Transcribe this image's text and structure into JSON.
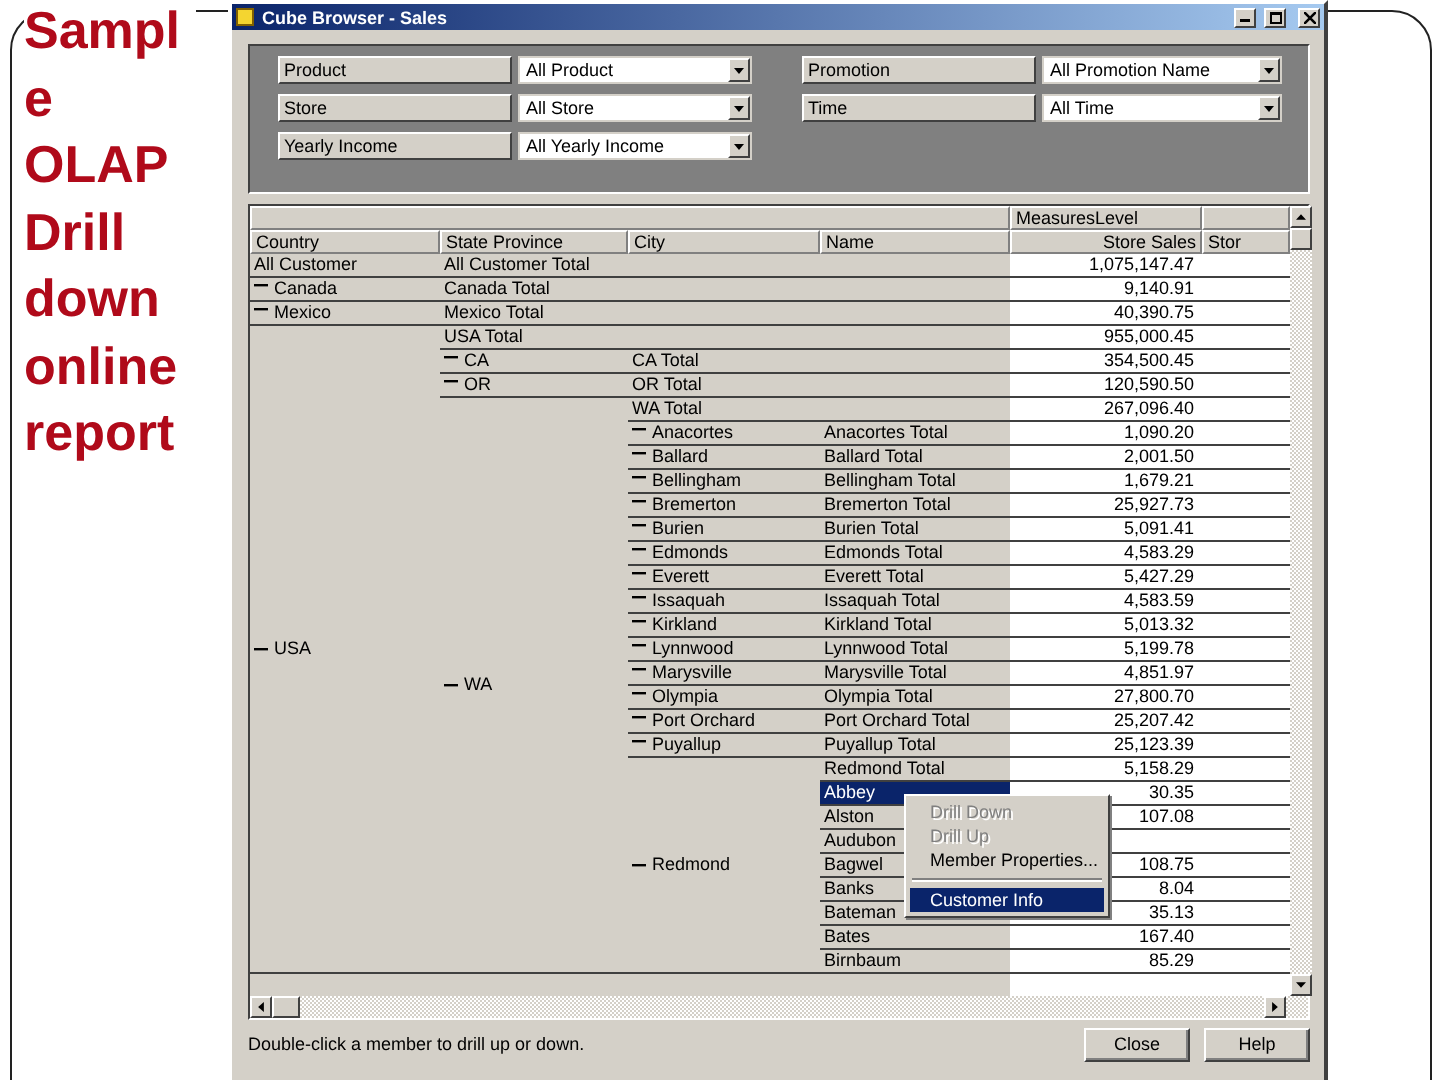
{
  "slide_title": "Sample OLAP Drill down online report",
  "window": {
    "title": "Cube Browser - Sales"
  },
  "filters": [
    {
      "label": "Product",
      "value": "All Product"
    },
    {
      "label": "Promotion",
      "value": "All Promotion Name"
    },
    {
      "label": "Store",
      "value": "All Store"
    },
    {
      "label": "Time",
      "value": "All Time"
    },
    {
      "label": "Yearly Income",
      "value": "All Yearly Income"
    }
  ],
  "grid": {
    "measures_header": "MeasuresLevel",
    "columns": [
      "Country",
      "State Province",
      "City",
      "Name",
      "Store Sales",
      "Stor"
    ],
    "members": [
      {
        "name": "All Customer",
        "total": "All Customer Total",
        "value": "1,075,147.47"
      },
      {
        "name": "Canada",
        "expanded": true,
        "total": "Canada Total",
        "value": "9,140.91"
      },
      {
        "name": "Mexico",
        "expanded": true,
        "total": "Mexico Total",
        "value": "40,390.75"
      },
      {
        "name": "USA",
        "expanded": true,
        "total": "USA Total",
        "value": "955,000.45",
        "children": [
          {
            "name": "CA",
            "expanded": true,
            "total": "CA Total",
            "value": "354,500.45"
          },
          {
            "name": "OR",
            "expanded": true,
            "total": "OR Total",
            "value": "120,590.50"
          },
          {
            "name": "WA",
            "expanded": true,
            "total": "WA Total",
            "value": "267,096.40",
            "children": [
              {
                "name": "Anacortes",
                "expanded": true,
                "total": "Anacortes Total",
                "value": "1,090.20"
              },
              {
                "name": "Ballard",
                "expanded": true,
                "total": "Ballard Total",
                "value": "2,001.50"
              },
              {
                "name": "Bellingham",
                "expanded": true,
                "total": "Bellingham Total",
                "value": "1,679.21"
              },
              {
                "name": "Bremerton",
                "expanded": true,
                "total": "Bremerton Total",
                "value": "25,927.73"
              },
              {
                "name": "Burien",
                "expanded": true,
                "total": "Burien Total",
                "value": "5,091.41"
              },
              {
                "name": "Edmonds",
                "expanded": true,
                "total": "Edmonds Total",
                "value": "4,583.29"
              },
              {
                "name": "Everett",
                "expanded": true,
                "total": "Everett Total",
                "value": "5,427.29"
              },
              {
                "name": "Issaquah",
                "expanded": true,
                "total": "Issaquah Total",
                "value": "4,583.59"
              },
              {
                "name": "Kirkland",
                "expanded": true,
                "total": "Kirkland Total",
                "value": "5,013.32"
              },
              {
                "name": "Lynnwood",
                "expanded": true,
                "total": "Lynnwood Total",
                "value": "5,199.78"
              },
              {
                "name": "Marysville",
                "expanded": true,
                "total": "Marysville Total",
                "value": "4,851.97"
              },
              {
                "name": "Olympia",
                "expanded": true,
                "total": "Olympia Total",
                "value": "27,800.70"
              },
              {
                "name": "Port Orchard",
                "expanded": true,
                "total": "Port Orchard Total",
                "value": "25,207.42"
              },
              {
                "name": "Puyallup",
                "expanded": true,
                "total": "Puyallup Total",
                "value": "25,123.39"
              },
              {
                "name": "Redmond",
                "expanded": true,
                "total": "Redmond Total",
                "value": "5,158.29",
                "children": [
                  {
                    "name": "Abbey",
                    "selected": true,
                    "value": "30.35"
                  },
                  {
                    "name": "Alston",
                    "selected": false,
                    "value": "107.08"
                  },
                  {
                    "name": "Audubon",
                    "selected": false
                  },
                  {
                    "name": "Bagwel",
                    "selected": false,
                    "value": "108.75"
                  },
                  {
                    "name": "Banks",
                    "selected": false,
                    "value": "8.04"
                  },
                  {
                    "name": "Bateman",
                    "selected": false,
                    "value": "35.13"
                  },
                  {
                    "name": "Bates",
                    "selected": false,
                    "value": "167.40"
                  },
                  {
                    "name": "Birnbaum",
                    "selected": false,
                    "value": "85.29"
                  }
                ]
              }
            ]
          }
        ]
      }
    ]
  },
  "context_menu": [
    {
      "label": "Drill Down",
      "disabled": true,
      "selected": false
    },
    {
      "label": "Drill Up",
      "disabled": true,
      "selected": false
    },
    {
      "label": "Member Properties...",
      "disabled": false,
      "selected": false
    },
    {
      "kind": "separator"
    },
    {
      "label": "Customer Info",
      "disabled": false,
      "selected": true
    }
  ],
  "status_bar": "Double-click a member to drill up or down.",
  "buttons": [
    "Close",
    "Help"
  ]
}
